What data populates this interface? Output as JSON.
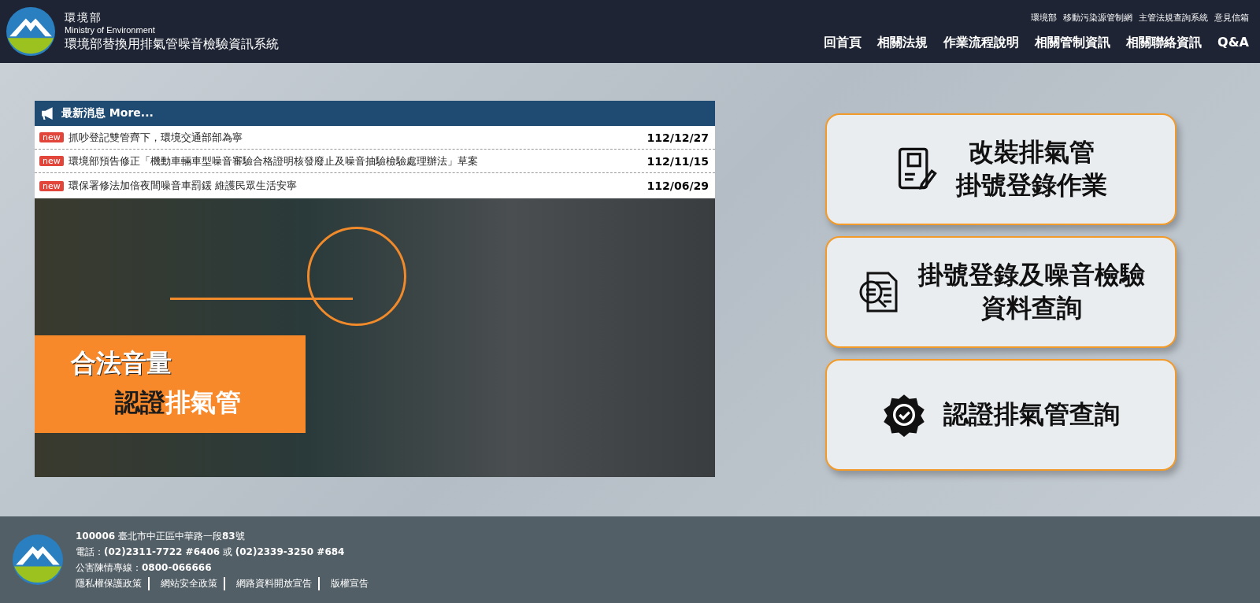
{
  "header": {
    "org_name": "環境部",
    "org_name_en": "Ministry of Environment",
    "site_title": "環境部替換用排氣管噪音檢驗資訊系統",
    "top_links": [
      "環境部",
      "移動污染源管制網",
      "主管法規查詢系統",
      "意見信箱"
    ],
    "nav": [
      "回首頁",
      "相關法規",
      "作業流程說明",
      "相關管制資訊",
      "相關聯絡資訊",
      "Q&A"
    ]
  },
  "news": {
    "title": "最新消息 More...",
    "items": [
      {
        "badge": "new",
        "title": "抓吵登記雙管齊下，環境交通部部為寧",
        "date": "112/12/27"
      },
      {
        "badge": "new",
        "title": "環境部預告修正「機動車輛車型噪音審驗合格證明核發廢止及噪音抽驗檢驗處理辦法」草案",
        "date": "112/11/15"
      },
      {
        "badge": "new",
        "title": "環保署修法加倍夜間噪音車罰鍰 維護民眾生活安寧",
        "date": "112/06/29"
      }
    ]
  },
  "banner": {
    "line_1": "合法音量",
    "line_2_a": "認證",
    "line_2_b": "排氣管"
  },
  "cards": [
    {
      "kind": "form",
      "lines": [
        "改裝排氣管",
        "掛號登錄作業"
      ]
    },
    {
      "kind": "search",
      "lines": [
        "掛號登錄及噪音檢驗",
        "資料查詢"
      ]
    },
    {
      "kind": "badge",
      "lines": [
        "認證排氣管查詢"
      ]
    }
  ],
  "footer": {
    "lines": [
      "**100006** 臺北市中正區中華路一段**83**號",
      "電話：**(02)2311-7722 #6406** 或 **(02)2339-3250 #684**",
      "公害陳情專線：**0800-066666**"
    ],
    "links": [
      "隱私權保護政策",
      "網站安全政策",
      "網路資料開放宣告",
      "版權宣告"
    ]
  }
}
